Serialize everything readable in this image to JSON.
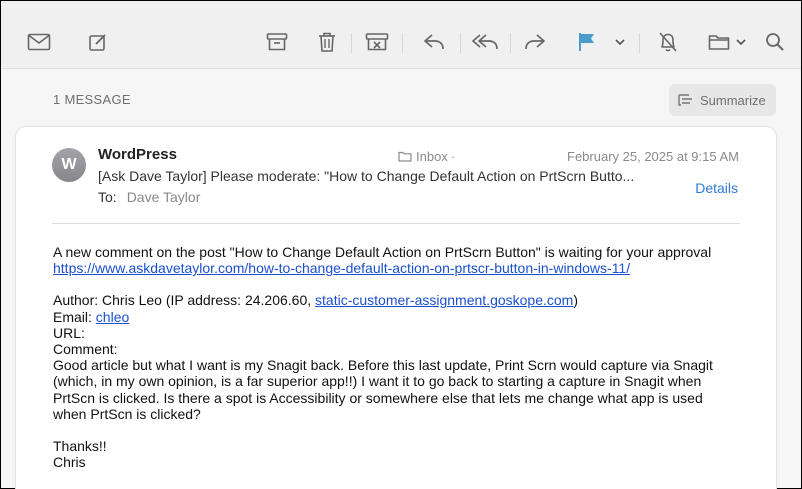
{
  "toolbar": {
    "icons": [
      "envelope-icon",
      "compose-icon",
      "archive-icon",
      "trash-icon",
      "junk-icon",
      "reply-icon",
      "reply-all-icon",
      "forward-icon",
      "flag-icon",
      "chevron-down-icon",
      "mute-bell-icon",
      "folder-icon",
      "search-icon"
    ],
    "flag_color": "#4a9cc9"
  },
  "message_count": "1 MESSAGE",
  "summarize_label": "Summarize",
  "email": {
    "avatar_initial": "W",
    "sender": "WordPress",
    "folder": "Inbox",
    "date": "February 25, 2025 at 9:15 AM",
    "subject": "[Ask Dave Taylor] Please moderate: \"How to Change Default Action on PrtScrn Butto...",
    "details_label": "Details",
    "to_label": "To:",
    "to_name": "Dave Taylor",
    "body": {
      "intro": "A new comment on the post \"How to Change Default Action on PrtScrn Button\" is waiting for your approval",
      "post_link": "https://www.askdavetaylor.com/how-to-change-default-action-on-prtscr-button-in-windows-11/",
      "author_prefix": "Author: Chris Leo (IP address: 24.206.60, ",
      "author_host": "static-customer-assignment.goskope.com",
      "author_suffix": ")",
      "email_label": "Email: ",
      "email_value": "chleo",
      "url_label": "URL:",
      "comment_label": "Comment:",
      "comment_lines": [
        "Good article but what I want is my Snagit back.  Before this last update, Print Scrn would capture via Snagit",
        "(which, in my own opinion, is a far superior app!!)   I want it to go back to starting a capture in Snagit when",
        "PrtScn is clicked.   Is there a spot is Accessibility or somewhere else that lets me change what app is used",
        "when PrtScn is clicked?"
      ],
      "signoff": "Thanks!!",
      "signature": "Chris"
    }
  }
}
